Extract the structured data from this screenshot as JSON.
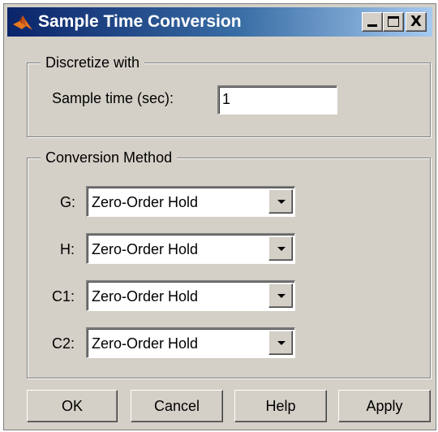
{
  "window": {
    "title": "Sample Time Conversion"
  },
  "titlebar_buttons": {
    "minimize": "_",
    "close": "X"
  },
  "discretize": {
    "group_label": "Discretize with",
    "sample_time_label": "Sample time (sec):",
    "sample_time_value": "1"
  },
  "conversion": {
    "group_label": "Conversion Method",
    "rows": [
      {
        "label": "G:",
        "value": "Zero-Order Hold"
      },
      {
        "label": "H:",
        "value": "Zero-Order Hold"
      },
      {
        "label": "C1:",
        "value": "Zero-Order Hold"
      },
      {
        "label": "C2:",
        "value": "Zero-Order Hold"
      }
    ]
  },
  "buttons": {
    "ok": "OK",
    "cancel": "Cancel",
    "help": "Help",
    "apply": "Apply"
  },
  "colors": {
    "face": "#d4d0c8",
    "title_start": "#0a246a",
    "title_end": "#a6caf0",
    "icon": "#e8781e"
  },
  "icons": {
    "app": "matlab-logo-icon",
    "minimize": "minimize-icon",
    "maximize": "maximize-icon",
    "close": "close-icon",
    "dropdown": "chevron-down-icon"
  }
}
